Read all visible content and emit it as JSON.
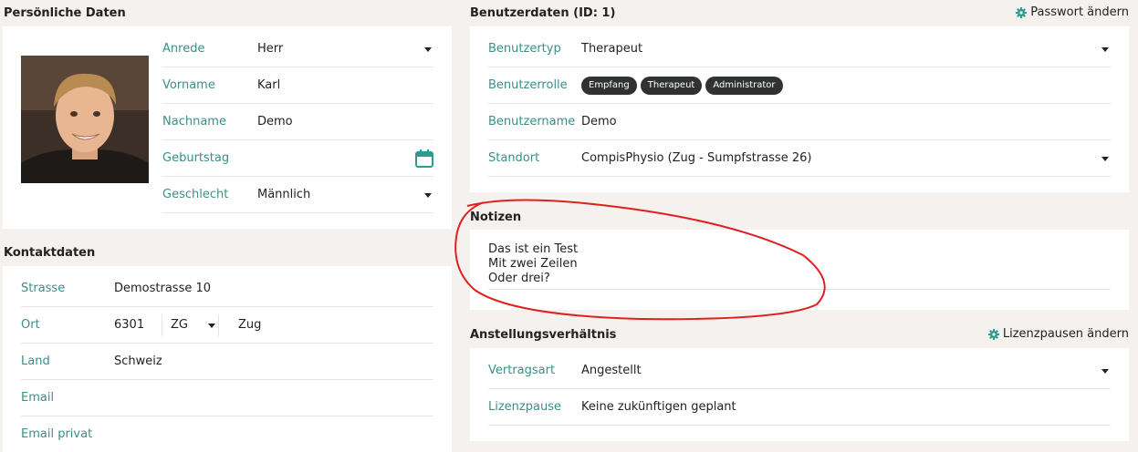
{
  "personal": {
    "title": "Persönliche Daten",
    "fields": [
      {
        "label": "Anrede",
        "value": "Herr"
      },
      {
        "label": "Vorname",
        "value": "Karl"
      },
      {
        "label": "Nachname",
        "value": "Demo"
      },
      {
        "label": "Geburtstag",
        "value": ""
      },
      {
        "label": "Geschlecht",
        "value": "Männlich"
      }
    ]
  },
  "contact": {
    "title": "Kontaktdaten",
    "strasse": {
      "label": "Strasse",
      "value": "Demostrasse 10"
    },
    "ort": {
      "label": "Ort",
      "plz": "6301",
      "kanton": "ZG",
      "ortname": "Zug"
    },
    "land": {
      "label": "Land",
      "value": "Schweiz"
    },
    "email": {
      "label": "Email",
      "value": ""
    },
    "email_privat": {
      "label": "Email privat",
      "value": ""
    }
  },
  "user": {
    "title": "Benutzerdaten (ID: 1)",
    "password_link": "Passwort ändern",
    "benutzertyp": {
      "label": "Benutzertyp",
      "value": "Therapeut"
    },
    "benutzerrolle": {
      "label": "Benutzerrolle",
      "roles": [
        "Empfang",
        "Therapeut",
        "Administrator"
      ]
    },
    "benutzername": {
      "label": "Benutzername",
      "value": "Demo"
    },
    "standort": {
      "label": "Standort",
      "value": "CompisPhysio (Zug - Sumpfstrasse 26)"
    }
  },
  "notes": {
    "title": "Notizen",
    "lines": [
      "Das ist ein Test",
      "Mit zwei Zeilen",
      "Oder drei?"
    ]
  },
  "employment": {
    "title": "Anstellungsverhältnis",
    "license_link": "Lizenzpausen ändern",
    "vertragsart": {
      "label": "Vertragsart",
      "value": "Angestellt"
    },
    "lizenzpause": {
      "label": "Lizenzpause",
      "value": "Keine zukünftigen geplant"
    }
  },
  "colors": {
    "label": "#3a8f87",
    "badge": "#2f3133",
    "annotation": "#e02020",
    "accent": "#2a9d8f"
  }
}
